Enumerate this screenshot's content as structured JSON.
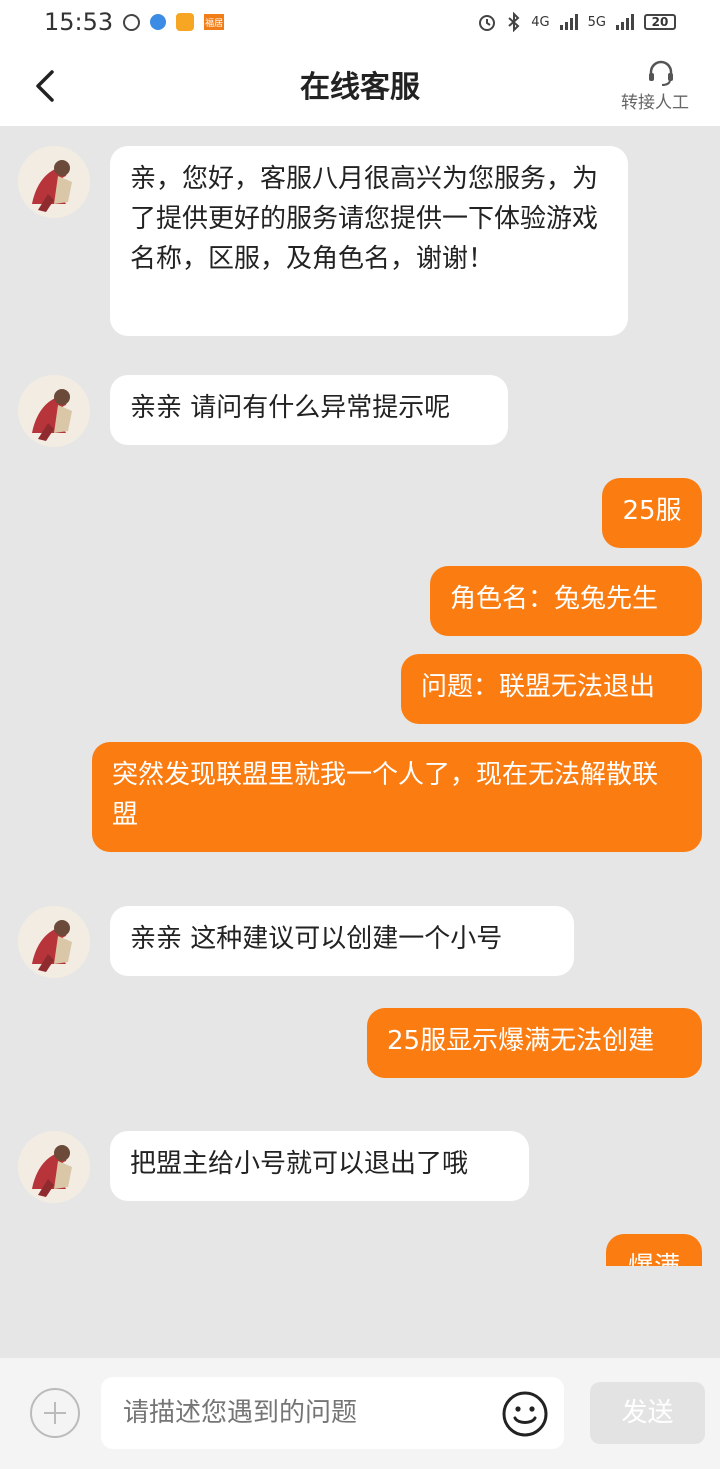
{
  "status_bar": {
    "time": "15:53",
    "battery": "20",
    "net1": "4G",
    "net2": "5G",
    "app_tag": "福居"
  },
  "nav": {
    "title": "在线客服",
    "human_label": "转接人工"
  },
  "messages": [
    {
      "from": "agent",
      "text": "亲，您好，客服八月很高兴为您服务，为了提供更好的服务请您提供一下体验游戏名称，区服，及角色名，谢谢！"
    },
    {
      "from": "agent",
      "text": "亲亲 请问有什么异常提示呢"
    },
    {
      "from": "user",
      "text": "25服"
    },
    {
      "from": "user",
      "text": "角色名：兔兔先生"
    },
    {
      "from": "user",
      "text": "问题：联盟无法退出"
    },
    {
      "from": "user",
      "text": "突然发现联盟里就我一个人了，现在无法解散联盟"
    },
    {
      "from": "agent",
      "text": "亲亲 这种建议可以创建一个小号"
    },
    {
      "from": "user",
      "text": "25服显示爆满无法创建"
    },
    {
      "from": "agent",
      "text": "把盟主给小号就可以退出了哦"
    },
    {
      "from": "user",
      "text": "爆满"
    }
  ],
  "input": {
    "placeholder": "请描述您遇到的问题",
    "send_label": "发送"
  },
  "colors": {
    "user_bubble": "#fb7d12",
    "agent_bubble": "#ffffff",
    "chat_bg": "#e6e6e6"
  }
}
